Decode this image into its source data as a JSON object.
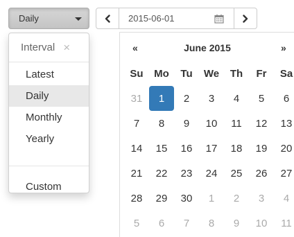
{
  "toolbar": {
    "interval_value": "Daily",
    "date_value": "2015-06-01",
    "prev_label": "‹",
    "next_label": "›",
    "calendar_icon": "calendar-icon"
  },
  "interval_menu": {
    "header": "Interval",
    "close": "×",
    "items": [
      "Latest",
      "Daily",
      "Monthly",
      "Yearly"
    ],
    "active_item": "Daily",
    "custom": "Custom"
  },
  "calendar": {
    "prev": "«",
    "title": "June 2015",
    "next": "»",
    "weekdays": [
      "Su",
      "Mo",
      "Tu",
      "We",
      "Th",
      "Fr",
      "Sa"
    ],
    "weeks": [
      [
        {
          "d": "31",
          "m": true
        },
        {
          "d": "1",
          "s": true
        },
        {
          "d": "2"
        },
        {
          "d": "3"
        },
        {
          "d": "4"
        },
        {
          "d": "5"
        },
        {
          "d": "6"
        }
      ],
      [
        {
          "d": "7"
        },
        {
          "d": "8"
        },
        {
          "d": "9"
        },
        {
          "d": "10"
        },
        {
          "d": "11"
        },
        {
          "d": "12"
        },
        {
          "d": "13"
        }
      ],
      [
        {
          "d": "14"
        },
        {
          "d": "15"
        },
        {
          "d": "16"
        },
        {
          "d": "17"
        },
        {
          "d": "18"
        },
        {
          "d": "19"
        },
        {
          "d": "20"
        }
      ],
      [
        {
          "d": "21"
        },
        {
          "d": "22"
        },
        {
          "d": "23"
        },
        {
          "d": "24"
        },
        {
          "d": "25"
        },
        {
          "d": "26"
        },
        {
          "d": "27"
        }
      ],
      [
        {
          "d": "28"
        },
        {
          "d": "29"
        },
        {
          "d": "30"
        },
        {
          "d": "1",
          "m": true
        },
        {
          "d": "2",
          "m": true
        },
        {
          "d": "3",
          "m": true
        },
        {
          "d": "4",
          "m": true
        }
      ],
      [
        {
          "d": "5",
          "m": true
        },
        {
          "d": "6",
          "m": true
        },
        {
          "d": "7",
          "m": true
        },
        {
          "d": "8",
          "m": true
        },
        {
          "d": "9",
          "m": true
        },
        {
          "d": "10",
          "m": true
        },
        {
          "d": "11",
          "m": true
        }
      ]
    ],
    "selected_color": "#337ab7"
  }
}
